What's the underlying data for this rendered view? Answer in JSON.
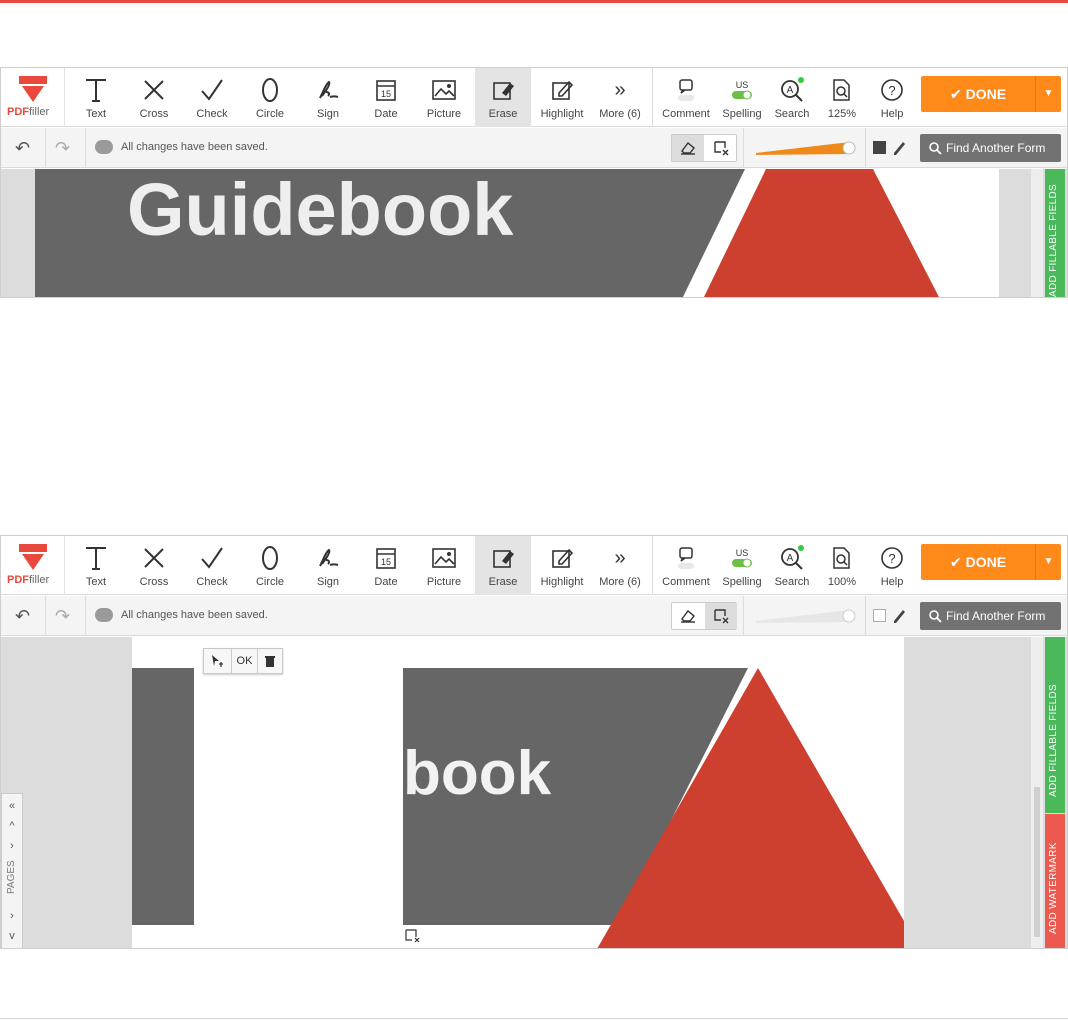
{
  "brand": {
    "name_pdf": "PDF",
    "name_filler": "filler",
    "accent": "#e8493c"
  },
  "tools": [
    {
      "label": "Text",
      "icon": "text-icon"
    },
    {
      "label": "Cross",
      "icon": "cross-icon"
    },
    {
      "label": "Check",
      "icon": "check-icon"
    },
    {
      "label": "Circle",
      "icon": "circle-icon"
    },
    {
      "label": "Sign",
      "icon": "sign-icon"
    },
    {
      "label": "Date",
      "icon": "date-icon",
      "glyph": "15"
    },
    {
      "label": "Picture",
      "icon": "picture-icon"
    },
    {
      "label": "Erase",
      "icon": "erase-icon",
      "active": true
    },
    {
      "label": "Highlight",
      "icon": "highlight-icon"
    },
    {
      "label": "More (6)",
      "icon": "more-icon"
    }
  ],
  "right_tools": {
    "comment": "Comment",
    "spelling": "Spelling",
    "spelling_lang": "US",
    "search": "Search",
    "help": "Help"
  },
  "done": {
    "label": "DONE",
    "color": "#ff8a1a"
  },
  "status": {
    "saved": "All changes have been saved."
  },
  "find_form": "Find Another Form",
  "side_tabs": {
    "fillable": "ADD FILLABLE FIELDS",
    "watermark": "ADD WATERMARK"
  },
  "pages_label": "PAGES",
  "float_toolbar": {
    "ok": "OK"
  },
  "screen1": {
    "zoom": "125%",
    "heading": "Guidebook",
    "slider_active": true
  },
  "screen2": {
    "zoom": "100%",
    "heading": "book",
    "slider_active": false
  },
  "colors": {
    "doc_gray": "#666666",
    "doc_red": "#cd3f2f",
    "fillable_tab": "#4cb85c",
    "watermark_tab": "#ec5a4f"
  }
}
